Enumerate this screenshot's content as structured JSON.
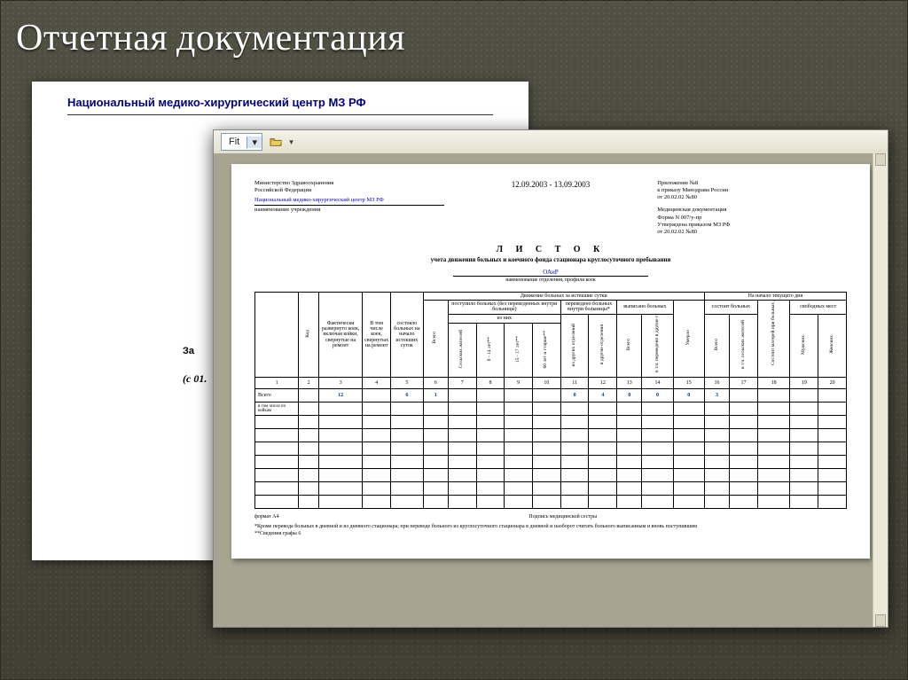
{
  "slide": {
    "title": "Отчетная документация"
  },
  "back_doc": {
    "heading": "Национальный медико-хирургический центр МЗ РФ",
    "line1": "За",
    "line2": "(с  01."
  },
  "viewer": {
    "zoom_label": "Fit"
  },
  "report": {
    "header_left": {
      "line1": "Министерство Здравоохранения",
      "line2": "Российской Федерации",
      "org": "Национальный медико-хирургический центр МЗ РФ",
      "org_caption": "наименование учреждения"
    },
    "date_range": "12.09.2003  -  13.09.2003",
    "header_right": {
      "line1": "Приложение №8",
      "line2": "к приказу Минздрава России",
      "line3": "от 20.02.02 №80",
      "form1": "Медицинская документация",
      "form2": "Форма N 007/у-пр",
      "form3": "Утверждена приказом МЗ РФ",
      "form4": "от 20.02.02 №80"
    },
    "title": "Л И С Т О К",
    "subtitle": "учета движения больных и коечного фонда стационара круглосуточного пребывания",
    "department": "ОАиР",
    "department_caption": "наименование отделения, профиля коек",
    "group_movement": "Движение больных за истекшие сутки",
    "group_nextday": "На начало текущего дня",
    "group_admitted": "поступило больных (без переведенных внутри больницы)",
    "group_admitted_sub": "из них",
    "group_transferred": "переведено больных внутри больницы*",
    "group_discharged": "выписано больных",
    "group_present": "состоит больных",
    "group_free": "свободных мест",
    "cols": {
      "1": "Код",
      "2": "Фактически развернуто коек, включая койки, свернутые на ремонт",
      "3": "В том числе коек, свернутых на ремонт",
      "4": "состояло больных на начало истекших суток",
      "5": "Всего",
      "6": "Сельских жителей",
      "7": "0 - 14 лет**",
      "8": "15 - 17 лет**",
      "9": "60 лет и старше**",
      "10": "из других отделений",
      "11": "в другие отделения",
      "12": "Всего",
      "13": "в т.ч. переведено в другие стационары",
      "14": "Умерло",
      "15": "Всего",
      "16": "в т.ч. сельских жителей",
      "17": "Состоит матерей при больных детях",
      "18": "Мужских",
      "19": "Женских"
    },
    "nums": [
      "1",
      "2",
      "3",
      "4",
      "5",
      "6",
      "7",
      "8",
      "9",
      "10",
      "11",
      "12",
      "13",
      "14",
      "15",
      "16",
      "17",
      "18",
      "19",
      "20"
    ],
    "rows": [
      {
        "label": "Всего",
        "v": [
          "12",
          "",
          "6",
          "1",
          "",
          "",
          "",
          "",
          "0",
          "4",
          "0",
          "0",
          "0",
          "3",
          "",
          "",
          "",
          "",
          ""
        ]
      },
      {
        "label": "в том числе по койкам",
        "v": []
      }
    ],
    "footer": {
      "format": "формат А4",
      "signature": "Подпись медицинской сестры",
      "note1": "*Кроме перевода больных в дневной и из дневного стационара; при переводе больного из круглосуточного стационара в дневной и наоборот считать больного выписанным и вновь поступившим",
      "note2": "**Сведения графы 6"
    }
  }
}
